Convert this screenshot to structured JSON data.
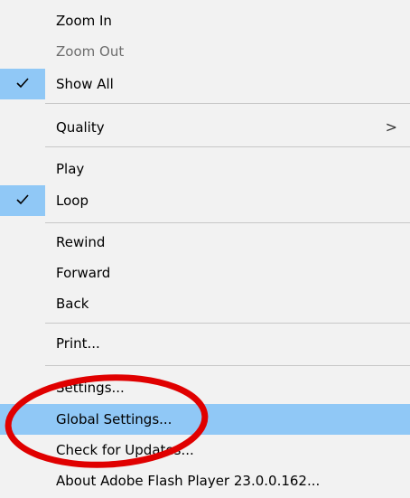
{
  "menu": {
    "zoom_in": "Zoom In",
    "zoom_out": "Zoom Out",
    "show_all": "Show All",
    "quality": "Quality",
    "quality_arrow": ">",
    "play": "Play",
    "loop": "Loop",
    "rewind": "Rewind",
    "forward": "Forward",
    "back": "Back",
    "print": "Print...",
    "settings": "Settings...",
    "global_settings": "Global Settings...",
    "check_updates": "Check for Updates...",
    "about": "About Adobe Flash Player 23.0.0.162..."
  },
  "state": {
    "show_all_checked": true,
    "loop_checked": true,
    "zoom_out_disabled": true,
    "highlighted_item": "Global Settings..."
  },
  "colors": {
    "menu_bg": "#f2f2f2",
    "highlight": "#90c8f6",
    "separator": "#c8c8c8",
    "annotation_circle": "#e00000"
  },
  "icons": {
    "check": "checkmark-icon",
    "submenu": "chevron-right-icon"
  }
}
